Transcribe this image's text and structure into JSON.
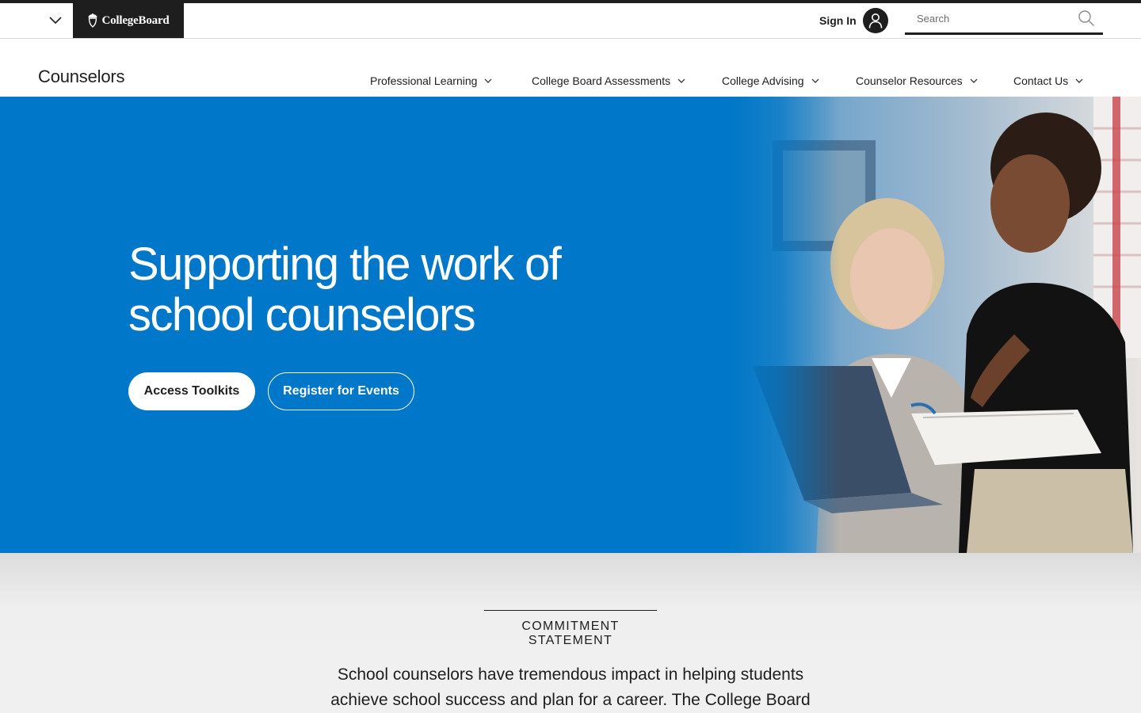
{
  "global_header": {
    "logo_text": "CollegeBoard",
    "signin_label": "Sign In",
    "search_placeholder": "Search"
  },
  "site_header": {
    "title": "Counselors",
    "nav": [
      {
        "label": "Professional Learning"
      },
      {
        "label": "College Board Assessments"
      },
      {
        "label": "College Advising"
      },
      {
        "label": "Counselor Resources"
      },
      {
        "label": "Contact Us"
      }
    ]
  },
  "hero": {
    "title_line1": "Supporting the work of",
    "title_line2": "school counselors",
    "primary_button": "Access Toolkits",
    "secondary_button": "Register for Events",
    "background_color": "#0077c8"
  },
  "commitment": {
    "eyebrow": "COMMITMENT STATEMENT",
    "text_line1": "School counselors have tremendous impact in helping students",
    "text_line2": "achieve school success and plan for a career. The College Board"
  },
  "colors": {
    "brand_dark": "#1e1e1e",
    "brand_blue": "#0077c8",
    "section_bg": "#f0f0f0"
  },
  "icons": [
    "chevron-down-icon",
    "acorn-logo-icon",
    "user-icon",
    "search-icon"
  ]
}
